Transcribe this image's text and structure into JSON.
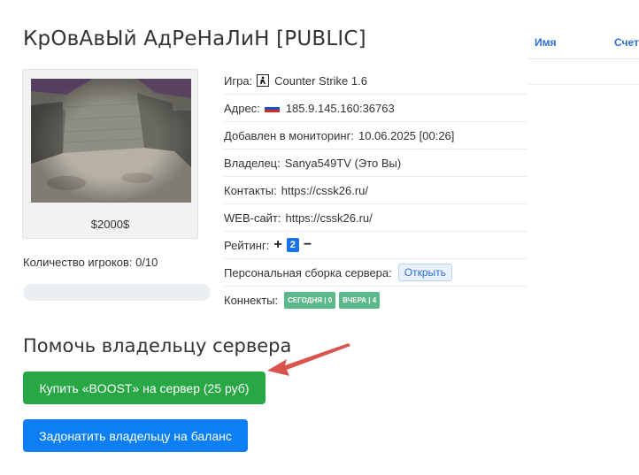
{
  "server": {
    "title": "КрОвАвЫй АдРеНаЛиН [PUBLIC]",
    "price": "$2000$",
    "players_label": "Количество игроков:",
    "players_value": "0/10",
    "players_fill_percent": 0
  },
  "info": {
    "game_label": "Игра:",
    "game_value": "Counter Strike 1.6",
    "address_label": "Адрес:",
    "address_value": "185.9.145.160:36763",
    "added_label": "Добавлен в мониторинг:",
    "added_value": "10.06.2025 [00:26]",
    "owner_label": "Владелец:",
    "owner_value": "Sanya549TV (Это Вы)",
    "contacts_label": "Контакты:",
    "contacts_value": "https://cssk26.ru/",
    "web_label": "WEB-сайт:",
    "web_value": "https://cssk26.ru/",
    "rating_label": "Рейтинг:",
    "rating_plus": "+",
    "rating_value": "2",
    "rating_minus": "−",
    "build_label": "Персональная сборка сервера:",
    "build_button": "Открыть",
    "connects_label": "Коннекты:",
    "connects_today": "СЕГОДНЯ | 0",
    "connects_yesterday": "ВЧЕРА | 4"
  },
  "help": {
    "title": "Помочь владельцу сервера",
    "boost_button": "Купить «BOOST» на сервер (25 руб)",
    "donate_button": "Задонатить владельцу на баланс"
  },
  "players_table": {
    "col_name": "Имя",
    "col_score": "Счет"
  },
  "colors": {
    "green": "#28a745",
    "blue": "#0d7ff5",
    "badge_green": "#5cb88a",
    "arrow": "#d9534f",
    "link_blue": "#2d6fd2"
  },
  "icons": [
    "counter-strike-icon",
    "russia-flag-icon",
    "red-arrow-annotation"
  ]
}
